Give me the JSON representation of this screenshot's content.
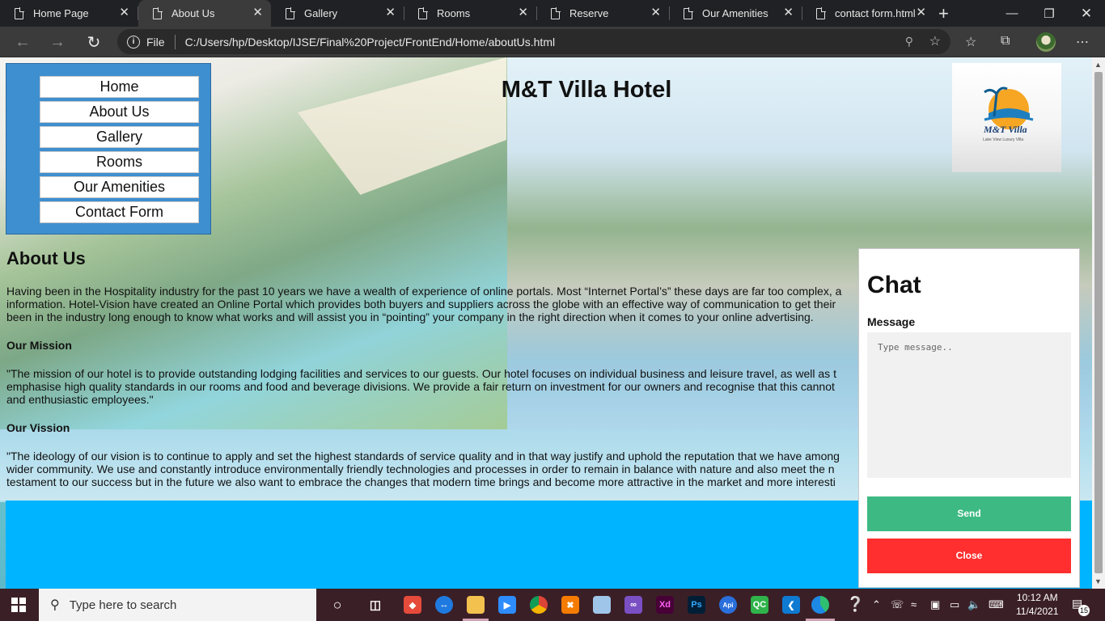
{
  "browser": {
    "tabs": [
      {
        "title": "Home Page",
        "active": false
      },
      {
        "title": "About Us",
        "active": true
      },
      {
        "title": "Gallery",
        "active": false
      },
      {
        "title": "Rooms",
        "active": false
      },
      {
        "title": "Reserve",
        "active": false
      },
      {
        "title": "Our Amenities",
        "active": false
      },
      {
        "title": "contact form.html",
        "active": false
      }
    ],
    "scheme_label": "File",
    "url": "C:/Users/hp/Desktop/IJSE/Final%20Project/FrontEnd/Home/aboutUs.html"
  },
  "site": {
    "title": "M&T Villa Hotel",
    "logo": {
      "brand": "M&T Villa",
      "tagline": "Lake View Luxury Villa"
    },
    "nav": [
      "Home",
      "About Us",
      "Gallery",
      "Rooms",
      "Our Amenities",
      "Contact Form"
    ]
  },
  "about": {
    "heading": "About Us",
    "intro_lines": [
      "Having been in the Hospitality industry for the past 10 years we have a wealth of experience of online portals. Most “Internet Portal’s” these days are far too complex, a",
      "information. Hotel-Vision have created an Online Portal which provides both buyers and suppliers across the globe with an effective way of communication to get their",
      "been in the industry long enough to know what works and will assist you in “pointing” your company in the right direction when it comes to your online advertising."
    ],
    "mission_heading": "Our Mission",
    "mission_lines": [
      "\"The mission of our hotel is to provide outstanding lodging facilities and services to our guests. Our hotel focuses on individual business and leisure travel, as well as t",
      "emphasise high quality standards in our rooms and food and beverage divisions. We provide a fair return on investment for our owners and recognise that this cannot",
      "and enthusiastic employees.\""
    ],
    "vision_heading": "Our Vission",
    "vision_lines": [
      "\"The ideology of our vision is to continue to apply and set the highest standards of service quality and in that way justify and uphold the reputation that we have among",
      "wider community. We use and constantly introduce environmentally friendly technologies and processes in order to remain in balance with nature and also meet the n",
      "testament to our success but in the future we also want to embrace the changes that modern time brings and become more attractive in the market and more interesti"
    ],
    "footer_fragments": [
      "n",
      "n",
      "v"
    ]
  },
  "chat": {
    "title": "Chat",
    "message_label": "Message",
    "placeholder": "Type message..",
    "send_label": "Send",
    "close_label": "Close"
  },
  "taskbar": {
    "search_placeholder": "Type here to search",
    "time": "10:12 AM",
    "date": "11/4/2021",
    "notification_count": "15"
  },
  "colors": {
    "nav_panel": "#3e8fd0",
    "footer_band": "#00b4ff",
    "send_button": "#3dba83",
    "close_button": "#ff2f2f"
  }
}
